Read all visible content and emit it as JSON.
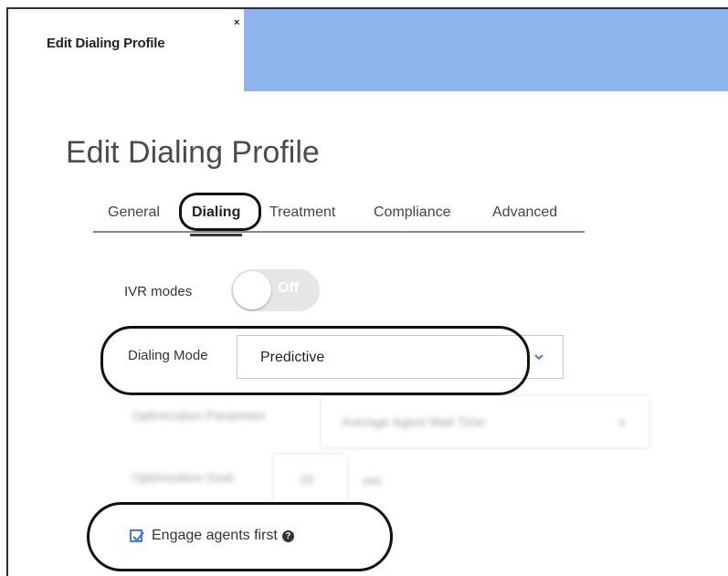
{
  "tab": {
    "label": "Edit Dialing Profile",
    "close": "×"
  },
  "page": {
    "title": "Edit Dialing Profile"
  },
  "subtabs": [
    "General",
    "Dialing",
    "Treatment",
    "Compliance",
    "Advanced"
  ],
  "active_subtab": "Dialing",
  "ivr": {
    "label": "IVR modes",
    "toggle_text": "Off",
    "enabled": false
  },
  "dialing_mode": {
    "label": "Dialing Mode",
    "value": "Predictive"
  },
  "optimization_parameter": {
    "label": "Optimization Parameter",
    "value": "Average Agent Wait Time"
  },
  "optimization_goal": {
    "label": "Optimization Goal",
    "value": "20",
    "unit": "sec"
  },
  "engage": {
    "label": "Engage agents first",
    "checked": true
  },
  "colors": {
    "accent": "#8fb5ef",
    "checkbox": "#4a7bd0",
    "annotation": "#111111"
  }
}
